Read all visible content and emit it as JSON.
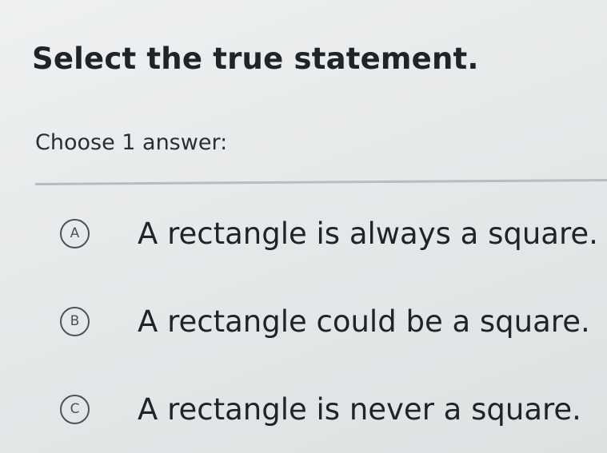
{
  "question": {
    "title": "Select the true statement.",
    "prompt": "Choose 1 answer:"
  },
  "choices": [
    {
      "letter": "A",
      "text": "A rectangle is always a square."
    },
    {
      "letter": "B",
      "text": "A rectangle could be a square."
    },
    {
      "letter": "C",
      "text": "A rectangle is never a square."
    }
  ]
}
